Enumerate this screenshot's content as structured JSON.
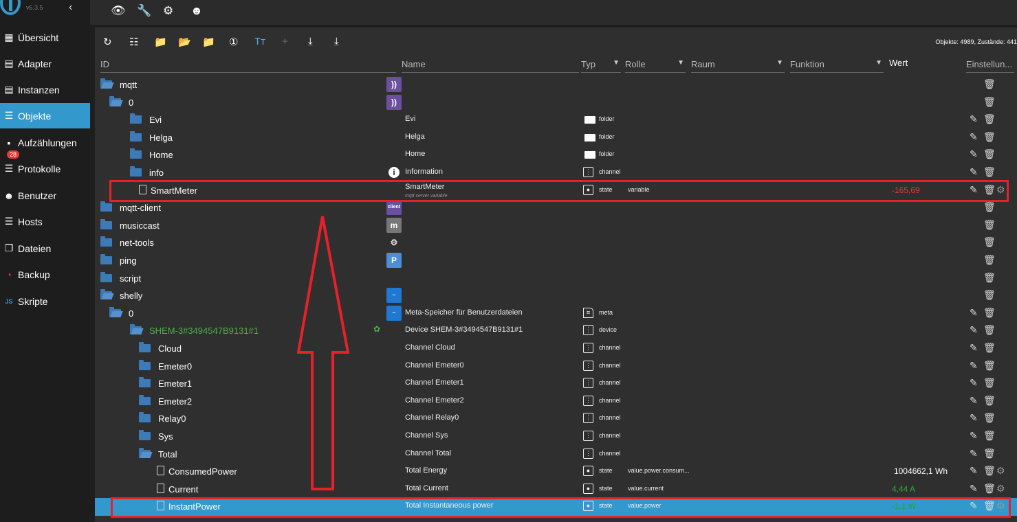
{
  "app": {
    "version": "v6.3.5"
  },
  "nav": [
    {
      "label": "Übersicht",
      "icon": "grid-icon"
    },
    {
      "label": "Adapter",
      "icon": "store-icon"
    },
    {
      "label": "Instanzen",
      "icon": "instances-icon"
    },
    {
      "label": "Objekte",
      "icon": "list-icon"
    },
    {
      "label": "Aufzählungen",
      "icon": "enums-icon"
    },
    {
      "label": "Protokolle",
      "icon": "log-icon",
      "badge": "28"
    },
    {
      "label": "Benutzer",
      "icon": "user-icon"
    },
    {
      "label": "Hosts",
      "icon": "hosts-icon"
    },
    {
      "label": "Dateien",
      "icon": "files-icon"
    },
    {
      "label": "Backup",
      "icon": "backup-icon"
    },
    {
      "label": "Skripte",
      "icon": "js-icon"
    }
  ],
  "stats": "Objekte: 4989, Zustände: 441",
  "columns": {
    "id": "ID",
    "name": "Name",
    "typ": "Typ",
    "rolle": "Rolle",
    "raum": "Raum",
    "funktion": "Funktion",
    "wert": "Wert",
    "einstellungen": "Einstellun..."
  },
  "rows": [
    {
      "id": "mqtt",
      "level": 0,
      "icon": "folder-open",
      "thumb": "mqtt"
    },
    {
      "id": "0",
      "level": 1,
      "icon": "folder-open",
      "thumb": "mqtt"
    },
    {
      "id": "Evi",
      "level": 2,
      "icon": "folder",
      "name": "Evi",
      "type": "folder"
    },
    {
      "id": "Helga",
      "level": 2,
      "icon": "folder",
      "name": "Helga",
      "type": "folder"
    },
    {
      "id": "Home",
      "level": 2,
      "icon": "folder",
      "name": "Home",
      "type": "folder"
    },
    {
      "id": "info",
      "level": 2,
      "icon": "folder",
      "name": "Information",
      "type": "channel",
      "thumb": "info"
    },
    {
      "id": "SmartMeter",
      "level": 2,
      "icon": "file",
      "name": "SmartMeter",
      "subname": "mqtt server variable",
      "type": "state",
      "role": "variable",
      "value": "-165,69",
      "valueColor": "#e53935"
    },
    {
      "id": "mqtt-client",
      "level": 0,
      "icon": "folder",
      "thumb": "client"
    },
    {
      "id": "musiccast",
      "level": 0,
      "icon": "folder",
      "thumb": "m"
    },
    {
      "id": "net-tools",
      "level": 0,
      "icon": "folder",
      "thumb": "net"
    },
    {
      "id": "ping",
      "level": 0,
      "icon": "folder",
      "thumb": "P"
    },
    {
      "id": "script",
      "level": 0,
      "icon": "folder"
    },
    {
      "id": "shelly",
      "level": 0,
      "icon": "folder-open",
      "thumb": "shelly"
    },
    {
      "id": "0",
      "level": 1,
      "icon": "folder-open",
      "thumb": "shelly",
      "name": "Meta-Speicher für Benutzerdateien",
      "type": "meta"
    },
    {
      "id": "SHEM-3#3494547B9131#1",
      "level": 2,
      "icon": "folder-open",
      "idColor": "#4caf50",
      "wifi": true,
      "name": "Device SHEM-3#3494547B9131#1",
      "type": "device"
    },
    {
      "id": "Cloud",
      "level": 3,
      "icon": "folder",
      "name": "Channel Cloud",
      "type": "channel"
    },
    {
      "id": "Emeter0",
      "level": 3,
      "icon": "folder",
      "name": "Channel Emeter0",
      "type": "channel"
    },
    {
      "id": "Emeter1",
      "level": 3,
      "icon": "folder",
      "name": "Channel Emeter1",
      "type": "channel"
    },
    {
      "id": "Emeter2",
      "level": 3,
      "icon": "folder",
      "name": "Channel Emeter2",
      "type": "channel"
    },
    {
      "id": "Relay0",
      "level": 3,
      "icon": "folder",
      "name": "Channel Relay0",
      "type": "channel"
    },
    {
      "id": "Sys",
      "level": 3,
      "icon": "folder",
      "name": "Channel Sys",
      "type": "channel"
    },
    {
      "id": "Total",
      "level": 3,
      "icon": "folder-open",
      "name": "Channel Total",
      "type": "channel"
    },
    {
      "id": "ConsumedPower",
      "level": 4,
      "icon": "file",
      "name": "Total Energy",
      "type": "state",
      "role": "value.power.consum...",
      "value": "1004662,1 Wh",
      "valueColor": "#ffffff"
    },
    {
      "id": "Current",
      "level": 4,
      "icon": "file",
      "name": "Total Current",
      "type": "state",
      "role": "value.current",
      "value": "4,44 A",
      "valueColor": "#2eaa3a"
    },
    {
      "id": "InstantPower",
      "level": 4,
      "icon": "file",
      "name": "Total Instantaneous power",
      "type": "state",
      "role": "value.power",
      "value": "-1,1 W",
      "valueColor": "#1fa53a",
      "selected": true
    }
  ]
}
